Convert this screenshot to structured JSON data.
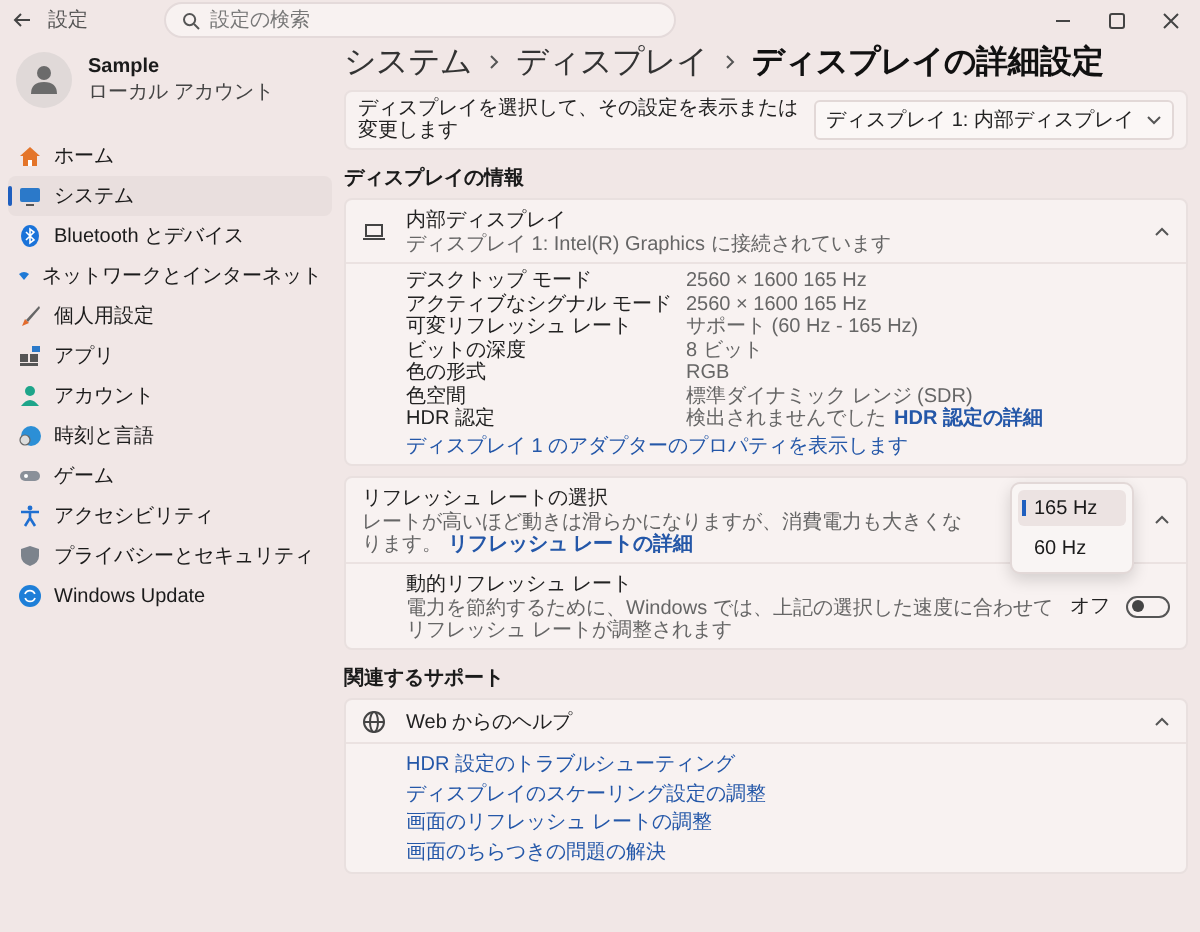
{
  "window": {
    "title": "設定",
    "search": {
      "placeholder": "設定の検索"
    }
  },
  "profile": {
    "name": "Sample",
    "account": "ローカル アカウント"
  },
  "sidebar": {
    "items": [
      {
        "label": "ホーム",
        "selected": false
      },
      {
        "label": "システム",
        "selected": true
      },
      {
        "label": "Bluetooth とデバイス",
        "selected": false
      },
      {
        "label": "ネットワークとインターネット",
        "selected": false
      },
      {
        "label": "個人用設定",
        "selected": false
      },
      {
        "label": "アプリ",
        "selected": false
      },
      {
        "label": "アカウント",
        "selected": false
      },
      {
        "label": "時刻と言語",
        "selected": false
      },
      {
        "label": "ゲーム",
        "selected": false
      },
      {
        "label": "アクセシビリティ",
        "selected": false
      },
      {
        "label": "プライバシーとセキュリティ",
        "selected": false
      },
      {
        "label": "Windows Update",
        "selected": false
      }
    ]
  },
  "breadcrumb": [
    "システム",
    "ディスプレイ",
    "ディスプレイの詳細設定"
  ],
  "display_select": {
    "label": "ディスプレイを選択して、その設定を表示または変更します",
    "value": "ディスプレイ 1: 内部ディスプレイ"
  },
  "display_info": {
    "heading": "ディスプレイの情報",
    "card": {
      "title": "内部ディスプレイ",
      "subtitle": "ディスプレイ 1: Intel(R) Graphics に接続されています",
      "expanded": true,
      "rows": [
        {
          "label": "デスクトップ モード",
          "value": "2560 × 1600 165 Hz"
        },
        {
          "label": "アクティブなシグナル モード",
          "value": "2560 × 1600 165 Hz"
        },
        {
          "label": "可変リフレッシュ レート",
          "value": "サポート (60 Hz - 165 Hz)"
        },
        {
          "label": "ビットの深度",
          "value": "8 ビット"
        },
        {
          "label": "色の形式",
          "value": "RGB"
        },
        {
          "label": "色空間",
          "value": "標準ダイナミック レンジ (SDR)"
        },
        {
          "label": "HDR 認定",
          "value": "検出されませんでした",
          "link": "HDR 認定の詳細"
        }
      ],
      "adapter_link": "ディスプレイ 1 のアダプターのプロパティを表示します"
    }
  },
  "refresh_rate": {
    "title": "リフレッシュ レートの選択",
    "subtitle": "レートが高いほど動きは滑らかになりますが、消費電力も大きくなります。",
    "link": "リフレッシュ レートの詳細",
    "expanded": true,
    "options": [
      {
        "label": "165 Hz",
        "selected": true
      },
      {
        "label": "60 Hz",
        "selected": false
      }
    ],
    "dynamic": {
      "title": "動的リフレッシュ レート",
      "subtitle": "電力を節約するために、Windows では、上記の選択した速度に合わせてリフレッシュ レートが調整されます",
      "state_label": "オフ",
      "on": false
    }
  },
  "related_support": {
    "heading": "関連するサポート",
    "card": {
      "title": "Web からのヘルプ",
      "expanded": true,
      "links": [
        "HDR 設定のトラブルシューティング",
        "ディスプレイのスケーリング設定の調整",
        "画面のリフレッシュ レートの調整",
        "画面のちらつきの問題の解決"
      ]
    }
  }
}
